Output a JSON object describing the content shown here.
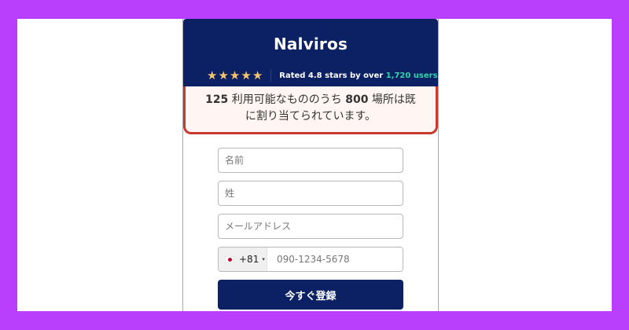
{
  "brand": {
    "name": "Nalviros"
  },
  "rating": {
    "stars": [
      "★",
      "★",
      "★",
      "★",
      "★"
    ],
    "prefix": "Rated 4.8 stars by over ",
    "count": "1,720 users",
    "suffix": "."
  },
  "alert": {
    "n1": "125",
    "t1": " 利用可能なもののうち ",
    "n2": "800",
    "t2": " 場所は既",
    "t3": "に割り当てられています。"
  },
  "form": {
    "first_name_placeholder": "名前",
    "last_name_placeholder": "姓",
    "email_placeholder": "メールアドレス",
    "phone_code": "+81",
    "phone_placeholder": "090-1234-5678",
    "submit_label": "今すぐ登録"
  },
  "colors": {
    "background": "#b93ffc",
    "header": "#0b2163",
    "alert_border": "#c83a2b",
    "accent_green": "#32d4a8",
    "star": "#f7c46b"
  }
}
